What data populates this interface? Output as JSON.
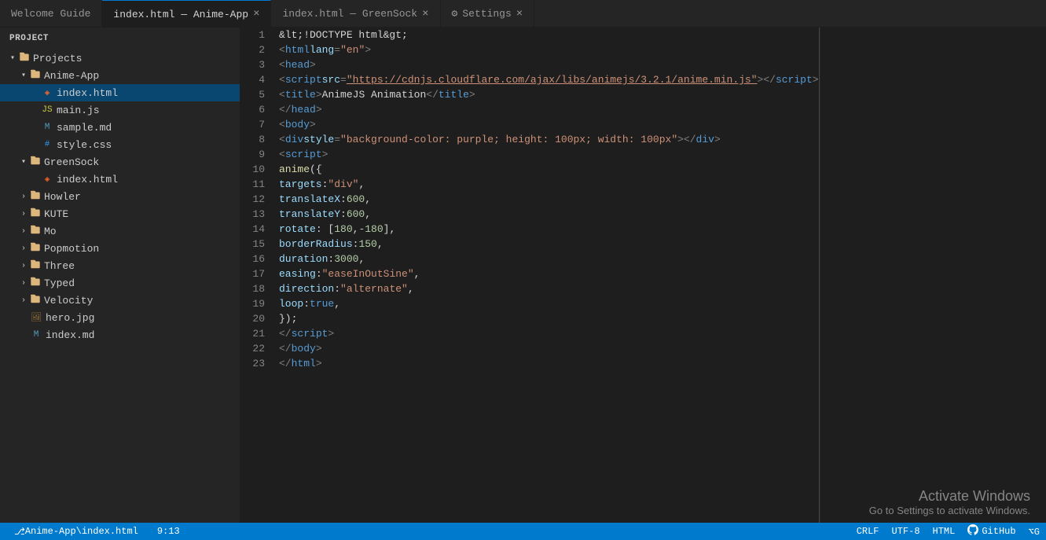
{
  "tabs": [
    {
      "id": "welcome",
      "label": "Welcome Guide",
      "active": false,
      "closable": false
    },
    {
      "id": "index-anime",
      "label": "index.html — Anime-App",
      "active": true,
      "closable": true
    },
    {
      "id": "index-greensock",
      "label": "index.html — GreenSock",
      "active": false,
      "closable": true
    },
    {
      "id": "settings",
      "label": "Settings",
      "active": false,
      "closable": true
    }
  ],
  "sidebar": {
    "header": "Project",
    "tree": [
      {
        "id": "projects",
        "label": "Projects",
        "type": "root-folder",
        "expanded": true,
        "indent": 0
      },
      {
        "id": "anime-app",
        "label": "Anime-App",
        "type": "folder",
        "expanded": true,
        "indent": 1
      },
      {
        "id": "index-html",
        "label": "index.html",
        "type": "html",
        "indent": 2,
        "active": true
      },
      {
        "id": "main-js",
        "label": "main.js",
        "type": "js",
        "indent": 2
      },
      {
        "id": "sample-md",
        "label": "sample.md",
        "type": "md",
        "indent": 2
      },
      {
        "id": "style-css",
        "label": "style.css",
        "type": "css",
        "indent": 2
      },
      {
        "id": "greensock",
        "label": "GreenSock",
        "type": "folder",
        "expanded": true,
        "indent": 1
      },
      {
        "id": "greensock-index",
        "label": "index.html",
        "type": "html",
        "indent": 2
      },
      {
        "id": "howler",
        "label": "Howler",
        "type": "folder",
        "expanded": false,
        "indent": 1
      },
      {
        "id": "kute",
        "label": "KUTE",
        "type": "folder",
        "expanded": false,
        "indent": 1
      },
      {
        "id": "mo",
        "label": "Mo",
        "type": "folder",
        "expanded": false,
        "indent": 1
      },
      {
        "id": "popmotion",
        "label": "Popmotion",
        "type": "folder",
        "expanded": false,
        "indent": 1
      },
      {
        "id": "three",
        "label": "Three",
        "type": "folder",
        "expanded": false,
        "indent": 1
      },
      {
        "id": "typed",
        "label": "Typed",
        "type": "folder",
        "expanded": false,
        "indent": 1
      },
      {
        "id": "velocity",
        "label": "Velocity",
        "type": "folder",
        "expanded": false,
        "indent": 1
      },
      {
        "id": "hero-jpg",
        "label": "hero.jpg",
        "type": "jpg",
        "indent": 1
      },
      {
        "id": "index-md",
        "label": "index.md",
        "type": "md",
        "indent": 1
      }
    ]
  },
  "editor": {
    "lines": [
      {
        "num": 1,
        "content": "<!DOCTYPE html>"
      },
      {
        "num": 2,
        "content": "<html lang=\"en\">"
      },
      {
        "num": 3,
        "content": "  <head>"
      },
      {
        "num": 4,
        "content": "    <script src=\"https://cdnjs.cloudflare.com/ajax/libs/animejs/3.2.1/anime.min.js\"><\\/script>"
      },
      {
        "num": 5,
        "content": "    <title>AnimeJS Animation<\\/title>"
      },
      {
        "num": 6,
        "content": "  <\\/head>"
      },
      {
        "num": 7,
        "content": "  <body>"
      },
      {
        "num": 8,
        "content": "    <div style=\"background-color: purple; height: 100px; width: 100px\"><\\/div>"
      },
      {
        "num": 9,
        "content": "    <script>"
      },
      {
        "num": 10,
        "content": "      anime({"
      },
      {
        "num": 11,
        "content": "        targets: \"div\","
      },
      {
        "num": 12,
        "content": "        translateX: 600,"
      },
      {
        "num": 13,
        "content": "        translateY: 600,"
      },
      {
        "num": 14,
        "content": "        rotate: [180, -180],"
      },
      {
        "num": 15,
        "content": "        borderRadius: 150,"
      },
      {
        "num": 16,
        "content": "        duration: 3000,"
      },
      {
        "num": 17,
        "content": "        easing: \"easeInOutSine\","
      },
      {
        "num": 18,
        "content": "        direction: \"alternate\","
      },
      {
        "num": 19,
        "content": "        loop: true,"
      },
      {
        "num": 20,
        "content": "      });"
      },
      {
        "num": 21,
        "content": "    <\\/script>"
      },
      {
        "num": 22,
        "content": "  <\\/body>"
      },
      {
        "num": 23,
        "content": "<\\/html>"
      }
    ]
  },
  "status_bar": {
    "branch": "Anime-App\\index.html",
    "position": "9:13",
    "eol": "CRLF",
    "encoding": "UTF-8",
    "language": "HTML",
    "github": "GitHub",
    "git_icon": "⎇ G",
    "activation_title": "Activate Windows",
    "activation_sub": "Go to Settings to activate Windows."
  }
}
